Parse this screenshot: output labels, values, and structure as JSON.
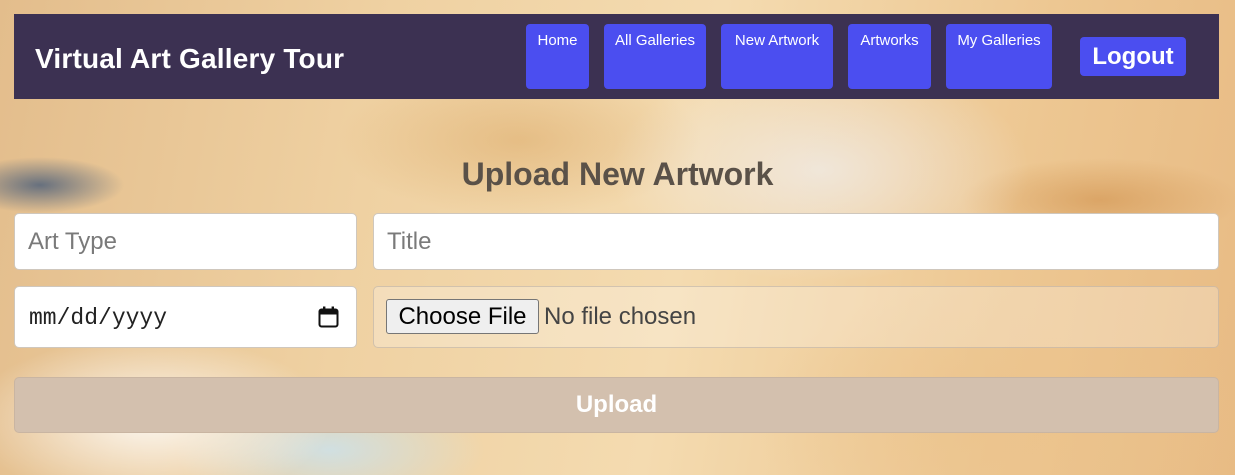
{
  "header": {
    "brand": "Virtual Art Gallery Tour",
    "nav": [
      {
        "label": "Home"
      },
      {
        "label": "All Galleries"
      },
      {
        "label": "New Artwork"
      },
      {
        "label": "Artworks"
      },
      {
        "label": "My Galleries"
      }
    ],
    "logout_label": "Logout"
  },
  "main": {
    "title": "Upload New Artwork",
    "art_type": {
      "placeholder": "Art Type",
      "value": ""
    },
    "artwork_title": {
      "placeholder": "Title",
      "value": ""
    },
    "date": {
      "display": "mm/dd/yyyy",
      "icon": "calendar-icon"
    },
    "file": {
      "button_label": "Choose File",
      "status": "No file chosen"
    },
    "upload_label": "Upload"
  },
  "colors": {
    "nav_bg": "#3c3152",
    "nav_button": "#4b4ef0",
    "title_text": "#5a5148",
    "upload_button": "#d3c0ae"
  }
}
